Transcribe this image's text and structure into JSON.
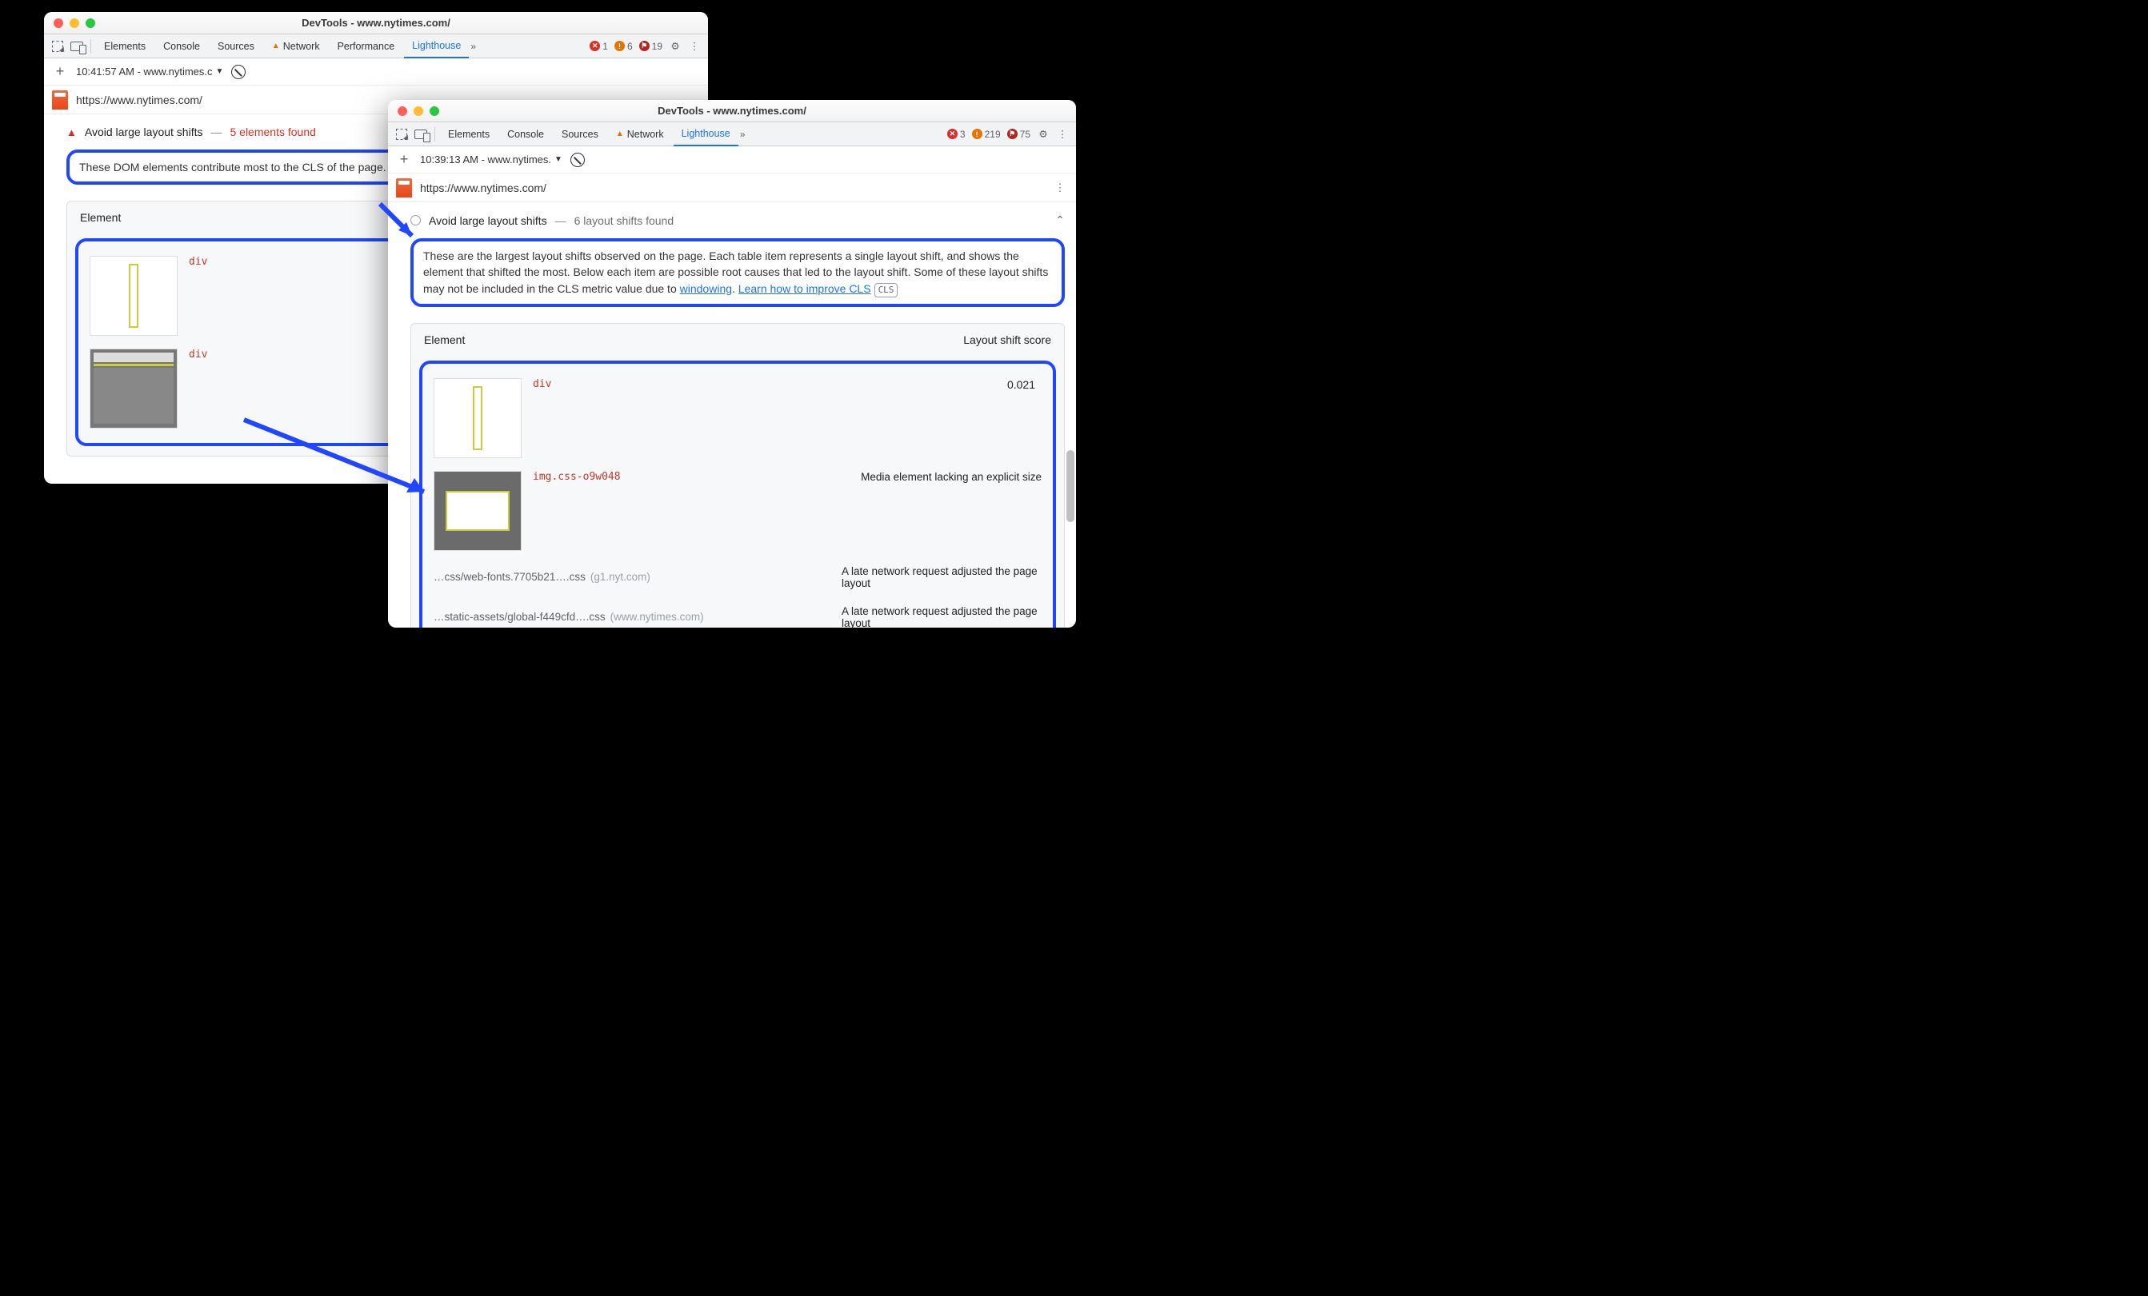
{
  "windows": {
    "back": {
      "title": "DevTools - www.nytimes.com/",
      "tabs": {
        "elements": "Elements",
        "console": "Console",
        "sources": "Sources",
        "network": "Network",
        "performance": "Performance",
        "lighthouse": "Lighthouse"
      },
      "badges": {
        "errors": 1,
        "warnings": 6,
        "info": 19
      },
      "snapshot": "10:41:57 AM - www.nytimes.c",
      "url": "https://www.nytimes.com/",
      "audit": {
        "name": "Avoid large layout shifts",
        "separator": "—",
        "count": "5 elements found"
      },
      "desc": "These DOM elements contribute most to the CLS of the page.",
      "table_head": "Element",
      "rows": [
        {
          "code": "div"
        },
        {
          "code": "div"
        }
      ]
    },
    "front": {
      "title": "DevTools - www.nytimes.com/",
      "tabs": {
        "elements": "Elements",
        "console": "Console",
        "sources": "Sources",
        "network": "Network",
        "lighthouse": "Lighthouse"
      },
      "badges": {
        "errors": 3,
        "warnings": 219,
        "info": 75
      },
      "snapshot": "10:39:13 AM - www.nytimes.",
      "url": "https://www.nytimes.com/",
      "audit": {
        "name": "Avoid large layout shifts",
        "separator": "—",
        "count": "6 layout shifts found"
      },
      "desc": {
        "text": "These are the largest layout shifts observed on the page. Each table item represents a single layout shift, and shows the element that shifted the most. Below each item are possible root causes that led to the layout shift. Some of these layout shifts may not be included in the CLS metric value due to ",
        "link1": "windowing",
        "sep": ". ",
        "link2": "Learn how to improve CLS",
        "chip": "CLS"
      },
      "table_head": {
        "left": "Element",
        "right": "Layout shift score"
      },
      "row1": {
        "code": "div",
        "score": "0.021"
      },
      "row2": {
        "code": "img.css-o9w048",
        "reason": "Media element lacking an explicit size"
      },
      "sub1": {
        "path": "…css/web-fonts.7705b21….css",
        "host": "(g1.nyt.com)",
        "reason": "A late network request adjusted the page layout"
      },
      "sub2": {
        "path": "…static-assets/global-f449cfd….css",
        "host": "(www.nytimes.com)",
        "reason": "A late network request adjusted the page layout"
      }
    }
  }
}
